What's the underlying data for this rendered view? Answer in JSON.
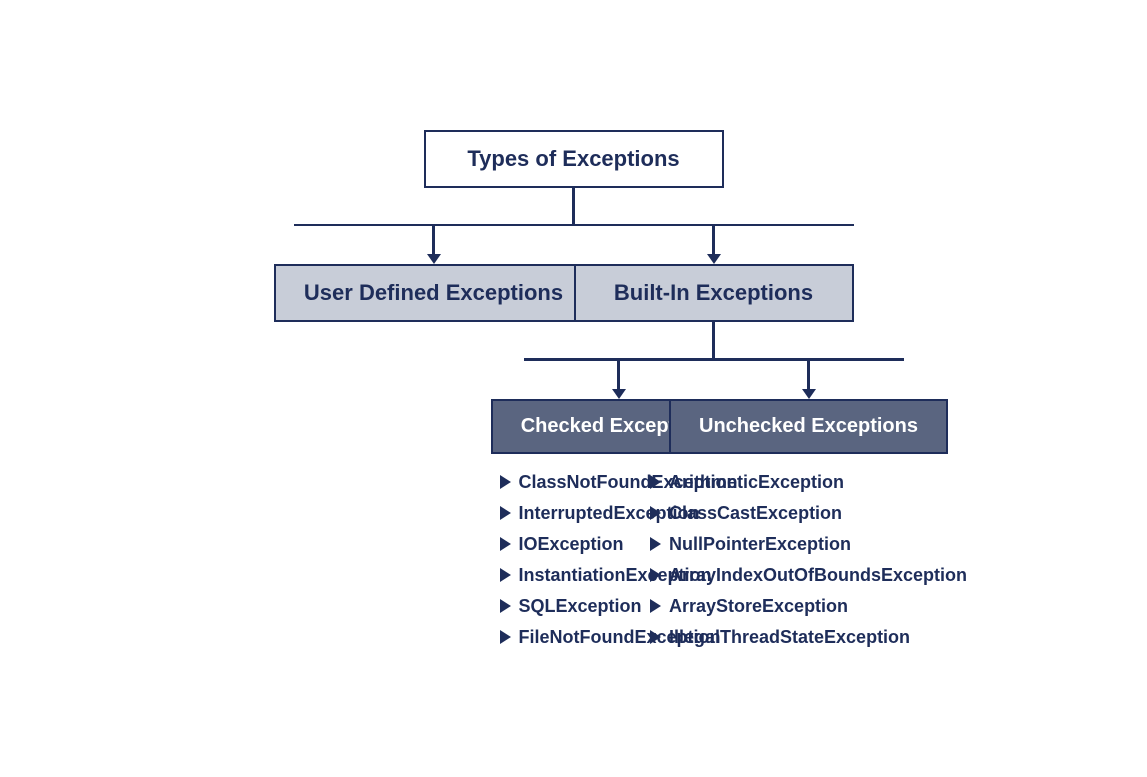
{
  "diagram": {
    "title": "Types of Exceptions",
    "level2": {
      "left": "User Defined Exceptions",
      "right": "Built-In Exceptions"
    },
    "level3": {
      "left": "Checked Exceptions",
      "right": "Unchecked Exceptions"
    },
    "checked_list": [
      "ClassNotFoundException",
      "InterruptedException",
      "IOException",
      "InstantiationException",
      "SQLException",
      "FileNotFoundException"
    ],
    "unchecked_list": [
      "ArithmeticException",
      "ClassCastException",
      "NullPointerException",
      "ArrayIndexOutOfBoundsException",
      "ArrayStoreException",
      "IllegalThreadStateException"
    ]
  }
}
